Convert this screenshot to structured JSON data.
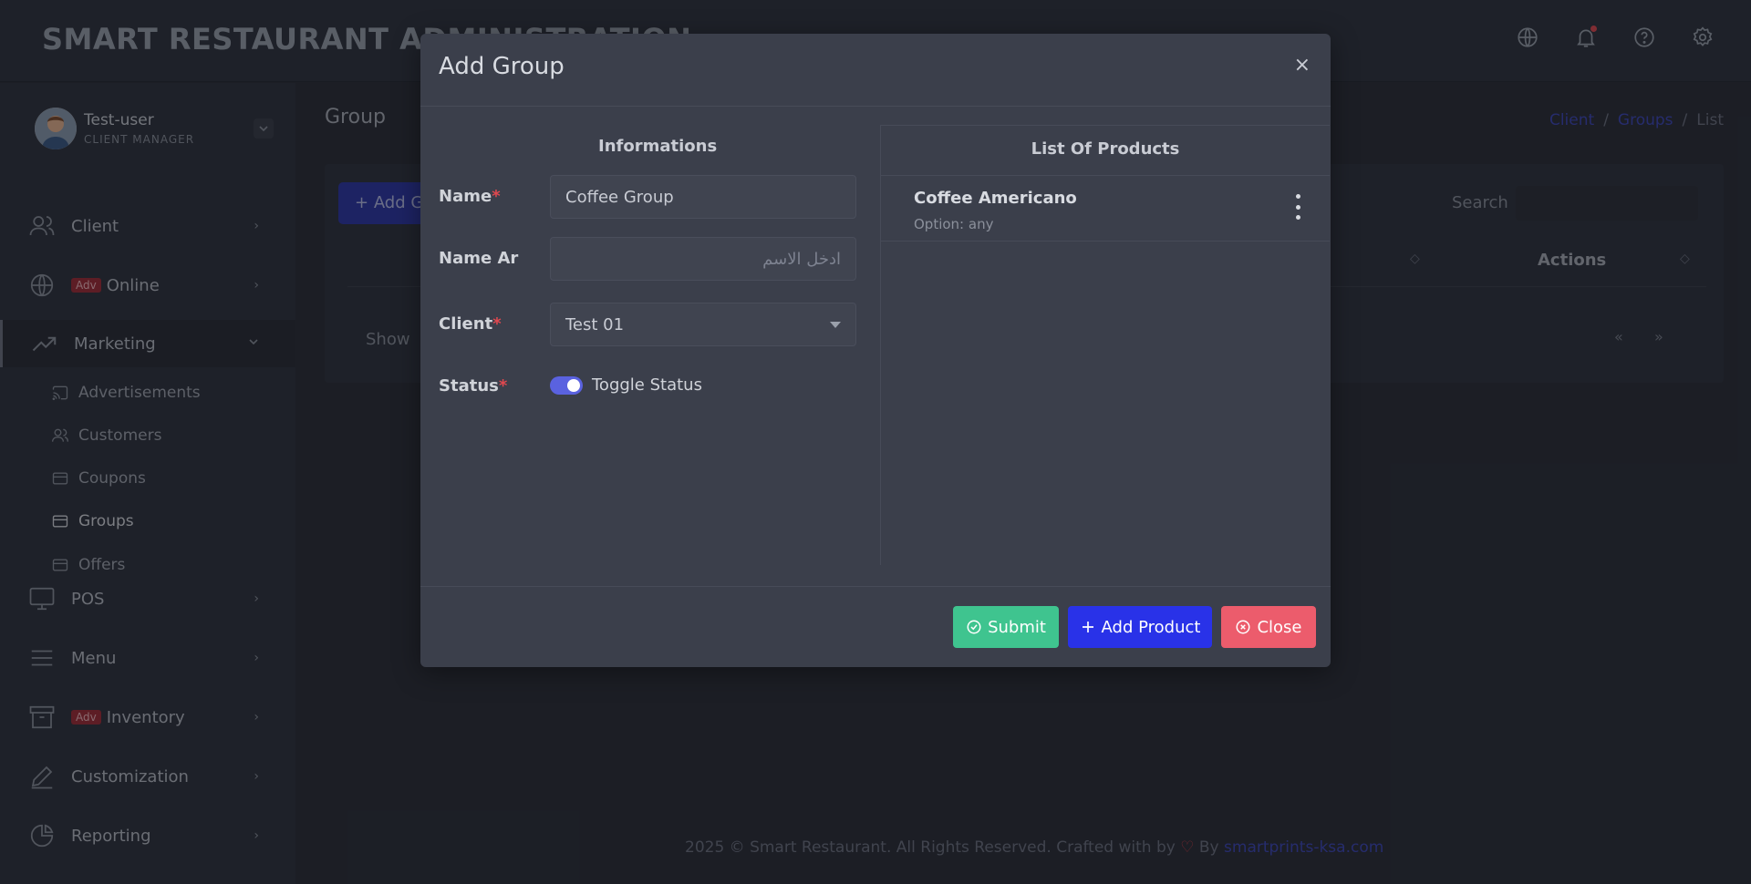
{
  "header": {
    "title": "SMART RESTAURANT ADMINISTRATION",
    "icons": [
      "globe-icon",
      "bell-icon",
      "help-icon",
      "gear-icon"
    ]
  },
  "user": {
    "name": "Test-user",
    "role": "CLIENT MANAGER"
  },
  "sidebar": {
    "items": [
      {
        "label": "Client",
        "icon": "users-icon",
        "badge": ""
      },
      {
        "label": "Online",
        "icon": "globe-icon",
        "badge": "Adv"
      },
      {
        "label": "Marketing",
        "icon": "trending-icon",
        "badge": ""
      },
      {
        "label": "POS",
        "icon": "monitor-icon",
        "badge": ""
      },
      {
        "label": "Menu",
        "icon": "menu-icon",
        "badge": ""
      },
      {
        "label": "Inventory",
        "icon": "archive-icon",
        "badge": "Adv"
      },
      {
        "label": "Customization",
        "icon": "pen-icon",
        "badge": ""
      },
      {
        "label": "Reporting",
        "icon": "pie-icon",
        "badge": ""
      }
    ],
    "marketing_sub": [
      {
        "label": "Advertisements",
        "icon": "cast-icon"
      },
      {
        "label": "Customers",
        "icon": "users-icon"
      },
      {
        "label": "Coupons",
        "icon": "card-icon"
      },
      {
        "label": "Groups",
        "icon": "card-icon"
      },
      {
        "label": "Offers",
        "icon": "card-icon"
      }
    ]
  },
  "main": {
    "page_title": "Group",
    "breadcrumb": [
      "Client",
      "Groups",
      "List"
    ],
    "add_button": "Add Group",
    "search_label": "Search",
    "actions_header": "Actions",
    "show_label": "Show",
    "pager_prev": "«",
    "pager_next": "»"
  },
  "modal": {
    "title": "Add Group",
    "close_symbol": "×",
    "informations_heading": "Informations",
    "name_label": "Name",
    "name_value": "Coffee Group",
    "name_ar_label": "Name Ar",
    "name_ar_placeholder": "ادخل الاسم",
    "client_label": "Client",
    "client_value": "Test 01",
    "status_label": "Status",
    "toggle_label": "Toggle Status",
    "status_on": true,
    "required_mark": "*",
    "products_heading": "List Of Products",
    "products": [
      {
        "name": "Coffee Americano",
        "option": "Option: any"
      }
    ],
    "buttons": {
      "submit": "Submit",
      "add_product": "Add Product",
      "close": "Close"
    }
  },
  "footer": {
    "text": "2025 © Smart Restaurant. All Rights Reserved. Crafted with by",
    "heart": "♡",
    "by": "By",
    "link": "smartprints-ksa.com"
  },
  "colors": {
    "submit": "#3fc48f",
    "add_product": "#2932e8",
    "close": "#ec5c6c",
    "link": "#3d46b8"
  }
}
